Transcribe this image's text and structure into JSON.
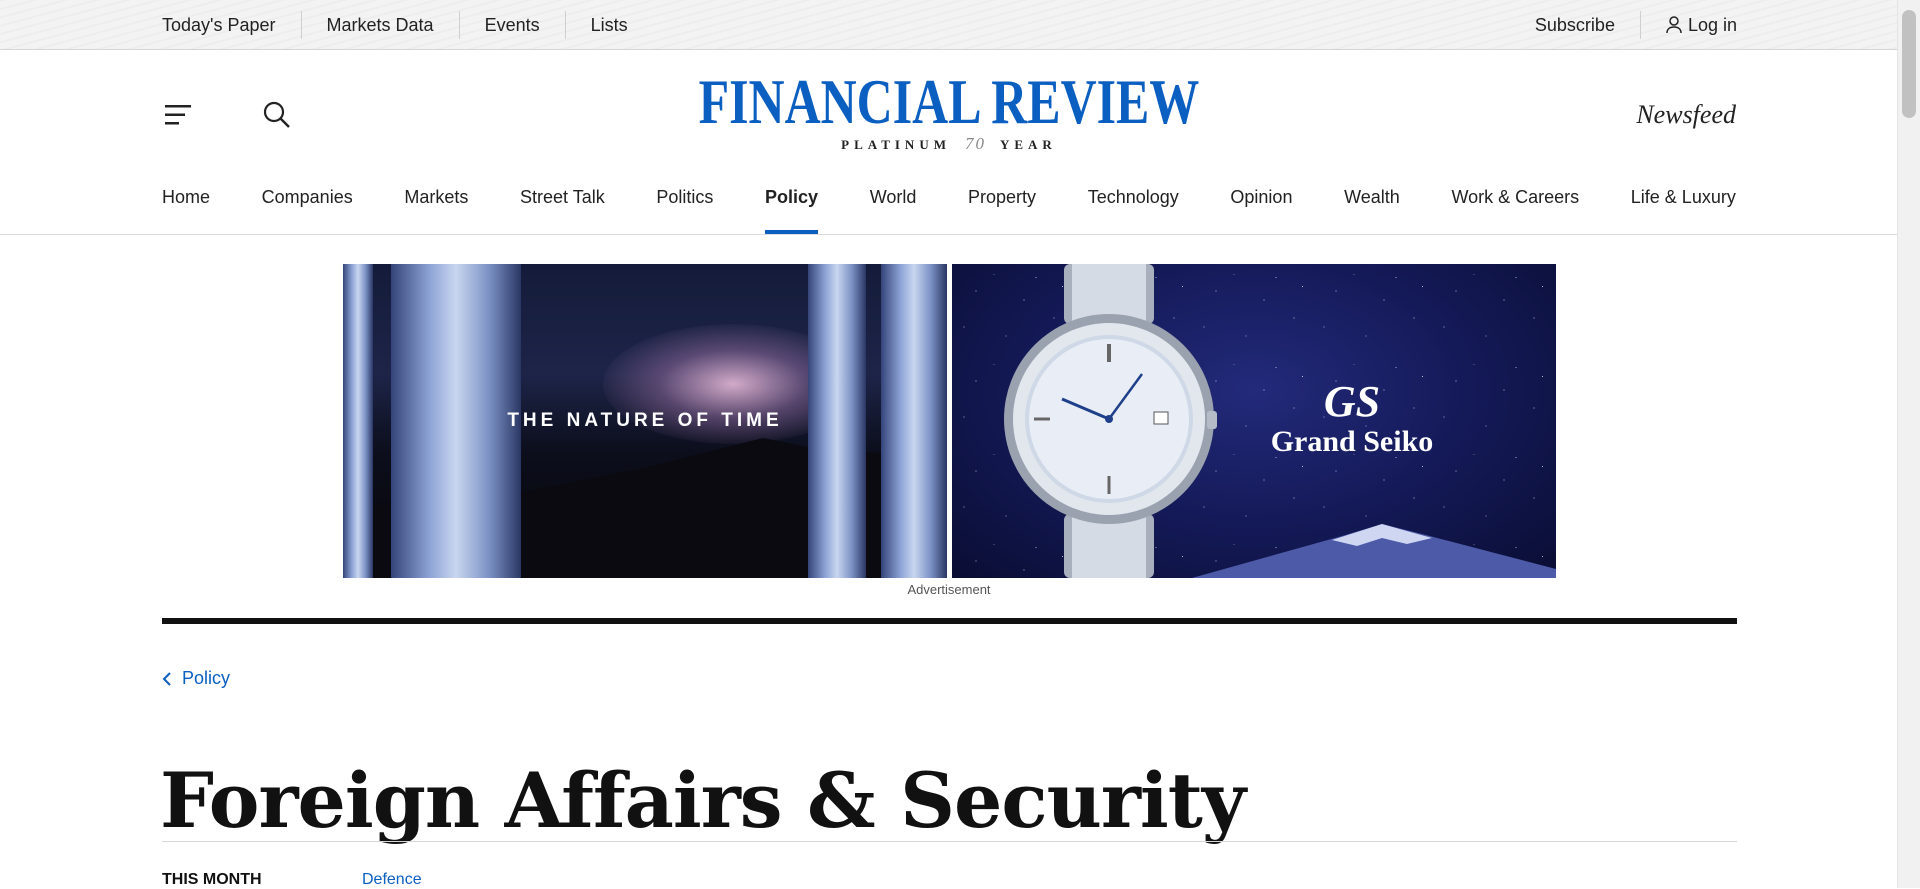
{
  "utility": {
    "left_links": [
      "Today's Paper",
      "Markets Data",
      "Events",
      "Lists"
    ],
    "subscribe": "Subscribe",
    "login": "Log in"
  },
  "masthead": {
    "brand": "FINANCIAL REVIEW",
    "tagline_left": "PLATINUM",
    "tagline_year": "70",
    "tagline_right": "YEAR",
    "newsfeed": "Newsfeed",
    "icons": {
      "menu": "menu-icon",
      "search": "search-icon"
    }
  },
  "nav": {
    "items": [
      "Home",
      "Companies",
      "Markets",
      "Street Talk",
      "Politics",
      "Policy",
      "World",
      "Property",
      "Technology",
      "Opinion",
      "Wealth",
      "Work & Careers",
      "Life & Luxury"
    ],
    "active": "Policy"
  },
  "ad": {
    "headline": "THE NATURE OF TIME",
    "brand_mark": "GS",
    "brand_name": "Grand Seiko",
    "label": "Advertisement"
  },
  "section": {
    "breadcrumb": "Policy",
    "title": "Foreign Affairs & Security",
    "this_month_label": "THIS MONTH",
    "first_tag": "Defence"
  },
  "colors": {
    "accent": "#0b5fc1",
    "text": "#111111",
    "rule": "#111111"
  }
}
